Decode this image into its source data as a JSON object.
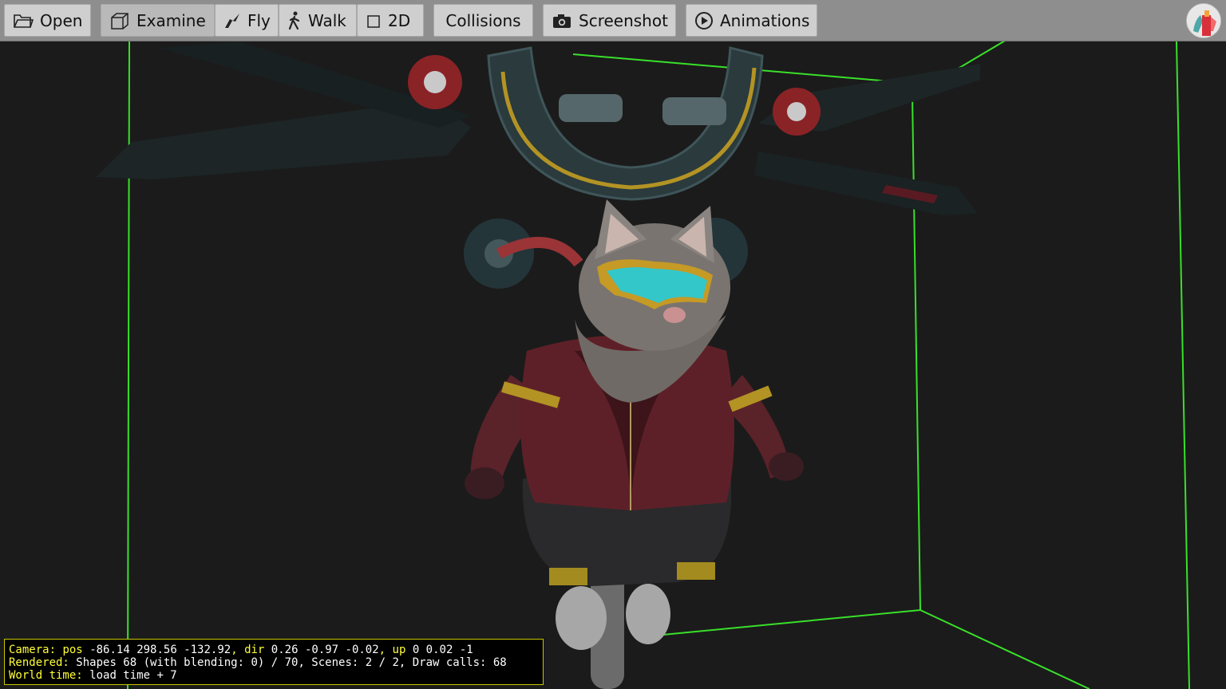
{
  "toolbar": {
    "open_label": "Open",
    "examine_label": "Examine",
    "fly_label": "Fly",
    "walk_label": "Walk",
    "twod_label": "2D",
    "collisions_label": "Collisions",
    "screenshot_label": "Screenshot",
    "animations_label": "Animations",
    "active_mode": "Examine"
  },
  "icons": {
    "open": "folder-icon",
    "examine": "cube-icon",
    "fly": "bird-icon",
    "walk": "walking-person-icon",
    "twod": "square-icon",
    "screenshot": "camera-icon",
    "animations": "play-circle-icon",
    "logo": "app-logo"
  },
  "hud": {
    "camera_key": "Camera:",
    "pos_key": "pos",
    "pos_value": "-86.14 298.56 -132.92",
    "dir_key": "dir",
    "dir_value": "0.26 -0.97 -0.02",
    "up_key": "up",
    "up_value": "0 0.02 -1",
    "rendered_key": "Rendered:",
    "rendered_value": "Shapes 68 (with blending: 0) / 70, Scenes: 2 / 2, Draw calls: 68",
    "world_time_key": "World time:",
    "world_time_value": "load time + 7"
  },
  "colors": {
    "background": "#1b1b1b",
    "bounding_box": "#39e02a",
    "hud_key": "#ffff3a",
    "hud_border": "#c8c800",
    "toolbar": "#8e8e8e"
  }
}
